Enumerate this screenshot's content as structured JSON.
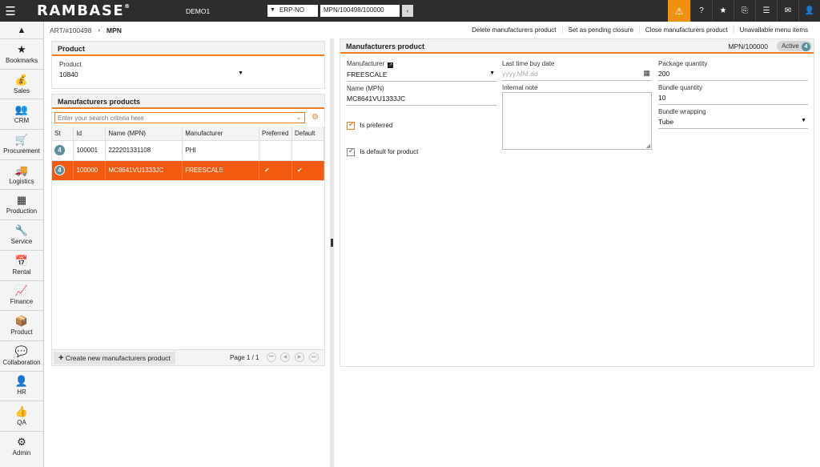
{
  "topbar": {
    "logo": "RAMBASE",
    "logo_mark": "®",
    "company": "DEMO1",
    "erp_select": "ERP-NO",
    "object_input": "MPN/100498/100000",
    "back_icon": "‹",
    "icons": [
      "warning-icon",
      "help-icon",
      "star-icon",
      "paperclip-icon",
      "list-icon",
      "mail-icon",
      "user-icon"
    ]
  },
  "sidebar": {
    "items": [
      {
        "label": "Bookmarks",
        "icon": "star-icon",
        "glyph": "★"
      },
      {
        "label": "Sales",
        "icon": "money-bag-icon",
        "glyph": "💰"
      },
      {
        "label": "CRM",
        "icon": "people-icon",
        "glyph": "👥"
      },
      {
        "label": "Procurement",
        "icon": "cart-icon",
        "glyph": "🛒"
      },
      {
        "label": "Logistics",
        "icon": "truck-icon",
        "glyph": "🚚"
      },
      {
        "label": "Production",
        "icon": "boxes-icon",
        "glyph": "▦"
      },
      {
        "label": "Service",
        "icon": "wrench-icon",
        "glyph": "🔧"
      },
      {
        "label": "Rental",
        "icon": "calendar-money-icon",
        "glyph": "📅"
      },
      {
        "label": "Finance",
        "icon": "chart-line-icon",
        "glyph": "📈"
      },
      {
        "label": "Product",
        "icon": "cube-icon",
        "glyph": "📦"
      },
      {
        "label": "Collaboration",
        "icon": "chat-icon",
        "glyph": "💬"
      },
      {
        "label": "HR",
        "icon": "person-icon",
        "glyph": "👤"
      },
      {
        "label": "QA",
        "icon": "thumbs-up-icon",
        "glyph": "👍"
      },
      {
        "label": "Admin",
        "icon": "gear-icon",
        "glyph": "⚙"
      }
    ]
  },
  "breadcrumb": {
    "parent": "ART/#100498",
    "current": "MPN"
  },
  "menu_actions": [
    "Delete manufacturers product",
    "Set as pending closure",
    "Close manufacturers product",
    "Unavailable menu items"
  ],
  "product_panel": {
    "title": "Product",
    "field_label": "Product",
    "field_value": "10840"
  },
  "list_panel": {
    "title": "Manufacturers products",
    "search_placeholder": "Enter your search criteria here",
    "columns": [
      "St",
      "Id",
      "Name (MPN)",
      "Manufacturer",
      "Preferred",
      "Default"
    ],
    "rows": [
      {
        "st": "4",
        "id": "100001",
        "name": "222201331108",
        "manufacturer": "PHI",
        "preferred": "",
        "default": ""
      },
      {
        "st": "4",
        "id": "100000",
        "name": "MC8641VU1333JC",
        "manufacturer": "FREESCALE",
        "preferred": "✔",
        "default": "✔"
      }
    ],
    "create_button": "Create new manufacturers product",
    "page_info": "Page 1 / 1"
  },
  "detail_panel": {
    "title": "Manufacturers product",
    "object_id": "MPN/100000",
    "status_label": "Active",
    "status_num": "4",
    "manufacturer_label": "Manufacturer",
    "manufacturer_value": "FREESCALE",
    "name_label": "Name (MPN)",
    "name_value": "MC8641VU1333JC",
    "is_preferred_label": "Is preferred",
    "is_default_label": "Is default for product",
    "last_buy_label": "Last time buy date",
    "last_buy_placeholder": "yyyy.MM.dd",
    "internal_note_label": "Internal note",
    "package_qty_label": "Package quantity",
    "package_qty_value": "200",
    "bundle_qty_label": "Bundle quantity",
    "bundle_qty_value": "10",
    "bundle_wrapping_label": "Bundle wrapping",
    "bundle_wrapping_value": "Tube"
  },
  "colors": {
    "accent": "#f07c1f",
    "selected_row": "#f25a0f",
    "topbar": "#2d2d2d",
    "warning": "#f0900e"
  }
}
